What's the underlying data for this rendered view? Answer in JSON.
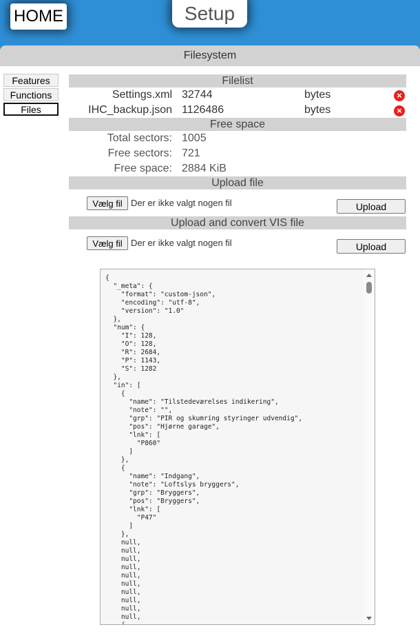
{
  "header": {
    "home_label": "HOME",
    "title": "Setup"
  },
  "panel": {
    "title": "Filesystem"
  },
  "tabs": [
    {
      "label": "Features",
      "active": false
    },
    {
      "label": "Functions",
      "active": false
    },
    {
      "label": "Files",
      "active": true
    }
  ],
  "filelist": {
    "title": "Filelist",
    "files": [
      {
        "name": "Settings.xml",
        "size": "32744",
        "unit": "bytes"
      },
      {
        "name": "IHC_backup.json",
        "size": "1126486",
        "unit": "bytes"
      }
    ]
  },
  "free_space": {
    "title": "Free space",
    "rows": [
      {
        "label": "Total sectors:",
        "value": "1005"
      },
      {
        "label": "Free sectors:",
        "value": "721"
      },
      {
        "label": "Free space:",
        "value": "2884 KiB"
      }
    ]
  },
  "upload_file": {
    "title": "Upload file",
    "choose_label": "Vælg fil",
    "no_file_text": "Der er ikke valgt nogen fil",
    "upload_label": "Upload"
  },
  "upload_vis": {
    "title": "Upload and convert VIS file",
    "choose_label": "Vælg fil",
    "no_file_text": "Der er ikke valgt nogen fil",
    "upload_label": "Upload"
  },
  "json_view": {
    "text": "{\n  \"_meta\": {\n    \"format\": \"custom-json\",\n    \"encoding\": \"utf-8\",\n    \"version\": \"1.0\"\n  },\n  \"num\": {\n    \"I\": 128,\n    \"O\": 128,\n    \"R\": 2684,\n    \"P\": 1143,\n    \"S\": 1282\n  },\n  \"in\": [\n    {\n      \"name\": \"Tilstedeværelses indikering\",\n      \"note\": \"\",\n      \"grp\": \"PIR og skumring styringer udvendig\",\n      \"pos\": \"Hjørne garage\",\n      \"lnk\": [\n        \"P860\"\n      ]\n    },\n    {\n      \"name\": \"Indgang\",\n      \"note\": \"Loftslys bryggers\",\n      \"grp\": \"Bryggers\",\n      \"pos\": \"Bryggers\",\n      \"lnk\": [\n        \"P47\"\n      ]\n    },\n    null,\n    null,\n    null,\n    null,\n    null,\n    null,\n    null,\n    null,\n    null,\n    null,\n    {"
  }
}
